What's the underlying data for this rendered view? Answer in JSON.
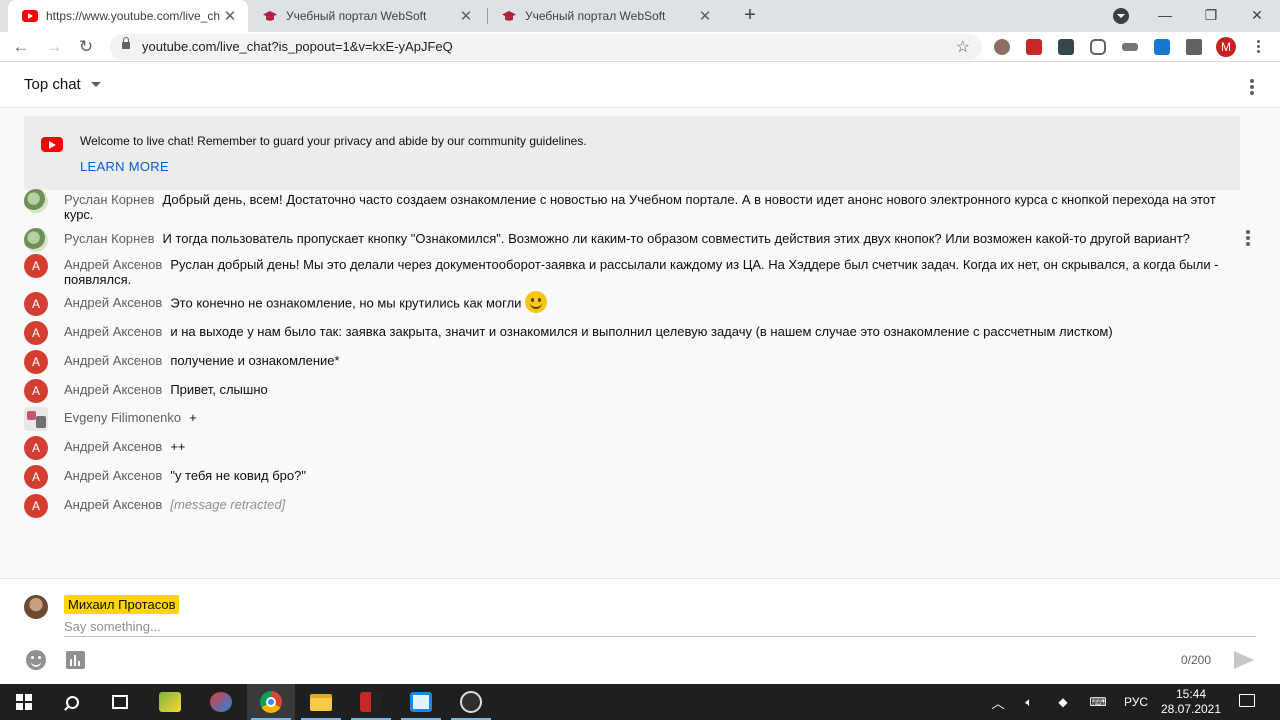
{
  "browser": {
    "tabs": [
      {
        "title": "https://www.youtube.com/live_chat",
        "icon": "youtube-icon"
      },
      {
        "title": "Учебный портал WebSoft",
        "icon": "graduation-cap-icon"
      },
      {
        "title": "Учебный портал WebSoft",
        "icon": "graduation-cap-icon"
      }
    ],
    "url": "youtube.com/live_chat?is_popout=1&v=kxE-yApJFeQ",
    "profile_initial": "M"
  },
  "chat": {
    "mode_label": "Top chat",
    "welcome": {
      "text": "Welcome to live chat! Remember to guard your privacy and abide by our community guidelines.",
      "link": "LEARN MORE"
    },
    "messages": [
      {
        "author": "Руслан Корнев",
        "avatar": "photo",
        "text": "Добрый день, всем! Достаточно часто создаем ознакомление с новостью на Учебном портале. А в новости идет анонс нового электронного курса с кнопкой перехода на этот курс."
      },
      {
        "author": "Руслан Корнев",
        "avatar": "photo",
        "text": "И тогда пользователь пропускает кнопку \"Ознакомился\". Возможно ли каким-то образом совместить действия этих двух кнопок? Или возможен какой-то другой вариант?"
      },
      {
        "author": "Андрей Аксенов",
        "avatar": "А",
        "text": "Руслан добрый день! Мы это делали через документооборот-заявка и рассылали каждому из ЦА. На Хэддере был счетчик задач. Когда их нет, он скрывался, а когда были - появлялся."
      },
      {
        "author": "Андрей Аксенов",
        "avatar": "А",
        "text": "Это конечно не ознакомление, но мы крутились как могли"
      },
      {
        "author": "Андрей Аксенов",
        "avatar": "А",
        "text": "и на выходе у нам было так: заявка закрыта, значит и ознакомился и выполнил целевую задачу (в нашем случае это ознакомление с рассчетным листком)"
      },
      {
        "author": "Андрей Аксенов",
        "avatar": "А",
        "text": "получение и ознакомление*"
      },
      {
        "author": "Андрей Аксенов",
        "avatar": "А",
        "text": "Привет, слышно"
      },
      {
        "author": "Evgeny Filimonenko",
        "avatar": "ev",
        "text": "+"
      },
      {
        "author": "Андрей Аксенов",
        "avatar": "А",
        "text": "++"
      },
      {
        "author": "Андрей Аксенов",
        "avatar": "А",
        "text": "\"у тебя не ковид бро?\""
      },
      {
        "author": "Андрей Аксенов",
        "avatar": "А",
        "text": "[message retracted]"
      }
    ],
    "input": {
      "user_name": "Михаил Протасов",
      "placeholder": "Say something...",
      "counter": "0/200"
    }
  },
  "taskbar": {
    "lang": "РУС",
    "time": "15:44",
    "date": "28.07.2021"
  },
  "colors": {
    "youtube_red": "#ff0000",
    "avatar_red": "#d23f31",
    "link_blue": "#065fd4",
    "name_highlight": "#ffd600"
  }
}
